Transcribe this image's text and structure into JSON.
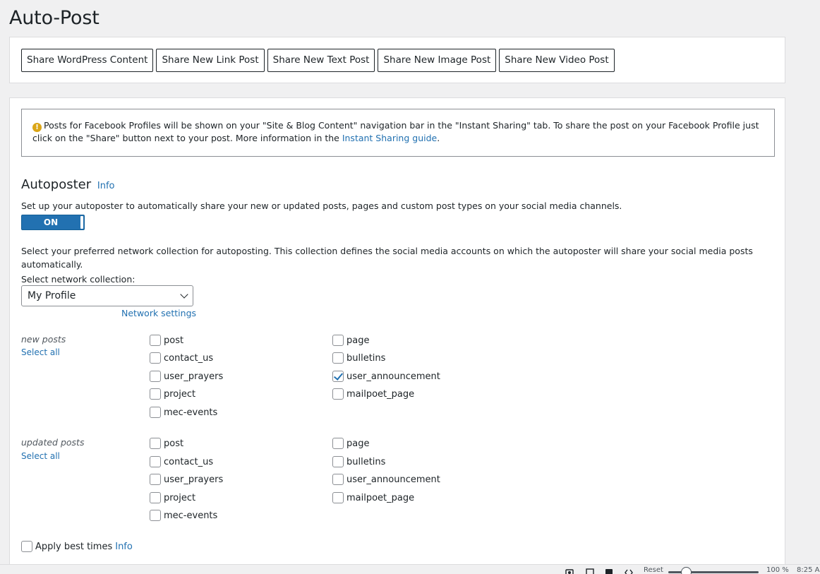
{
  "page": {
    "title": "Auto-Post"
  },
  "share_buttons": [
    "Share WordPress Content",
    "Share New Link Post",
    "Share New Text Post",
    "Share New Image Post",
    "Share New Video Post"
  ],
  "notice": {
    "text": "Posts for Facebook Profiles will be shown on your \"Site & Blog Content\" navigation bar in the \"Instant Sharing\" tab. To share the post on your Facebook Profile just click on the \"Share\" button next to your post. More information in the ",
    "link": "Instant Sharing guide",
    "suffix": "."
  },
  "autoposter": {
    "title": "Autoposter",
    "info": "Info",
    "description": "Set up your autoposter to automatically share your new or updated posts, pages and custom post types on your social media channels.",
    "toggle_label": "ON",
    "toggle_on": true,
    "collection_description": "Select your preferred network collection for autoposting. This collection defines the social media accounts on which the autoposter will share your social media posts automatically.",
    "select_label": "Select network collection:",
    "select_value": "My Profile",
    "network_settings": "Network settings"
  },
  "new_posts": {
    "label": "new posts",
    "select_all": "Select all",
    "left": [
      {
        "label": "post",
        "checked": false
      },
      {
        "label": "contact_us",
        "checked": false
      },
      {
        "label": "user_prayers",
        "checked": false
      },
      {
        "label": "project",
        "checked": false
      },
      {
        "label": "mec-events",
        "checked": false
      }
    ],
    "right": [
      {
        "label": "page",
        "checked": false
      },
      {
        "label": "bulletins",
        "checked": false
      },
      {
        "label": "user_announcement",
        "checked": true
      },
      {
        "label": "mailpoet_page",
        "checked": false
      }
    ]
  },
  "updated_posts": {
    "label": "updated posts",
    "select_all": "Select all",
    "left": [
      {
        "label": "post",
        "checked": false
      },
      {
        "label": "contact_us",
        "checked": false
      },
      {
        "label": "user_prayers",
        "checked": false
      },
      {
        "label": "project",
        "checked": false
      },
      {
        "label": "mec-events",
        "checked": false
      }
    ],
    "right": [
      {
        "label": "page",
        "checked": false
      },
      {
        "label": "bulletins",
        "checked": false
      },
      {
        "label": "user_announcement",
        "checked": false
      },
      {
        "label": "mailpoet_page",
        "checked": false
      }
    ]
  },
  "best_times": {
    "label": "Apply best times",
    "info": "Info",
    "checked": false
  },
  "statusbar": {
    "reset": "Reset",
    "zoom_percent": 100,
    "zoom": "100 %",
    "time": "8:25 A"
  }
}
